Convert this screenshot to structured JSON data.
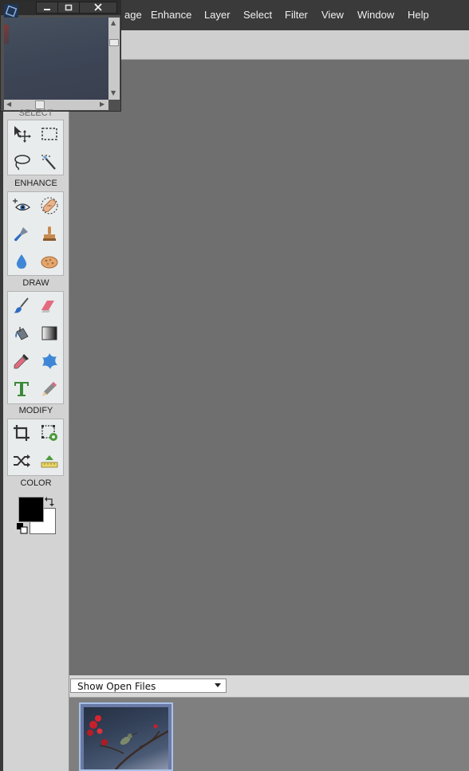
{
  "menubar": {
    "items": [
      "age",
      "Enhance",
      "Layer",
      "Select",
      "Filter",
      "View",
      "Window",
      "Help"
    ]
  },
  "toolbox": {
    "sections": {
      "select": "SELECT",
      "enhance": "ENHANCE",
      "draw": "DRAW",
      "modify": "MODIFY",
      "color": "COLOR"
    }
  },
  "colors": {
    "foreground": "#000000",
    "background": "#ffffff"
  },
  "bin": {
    "select_label": "Show Open Files",
    "thumbnail": "hummingbird-photo"
  },
  "icons": {
    "app": "elements-app-icon",
    "window_buttons": [
      "minimize-icon",
      "maximize-icon",
      "close-icon"
    ],
    "tools": [
      "move-tool-icon",
      "marquee-tool-icon",
      "lasso-tool-icon",
      "quick-selection-tool-icon",
      "red-eye-tool-icon",
      "spot-healing-tool-icon",
      "smart-brush-tool-icon",
      "clone-stamp-tool-icon",
      "blur-tool-icon",
      "sponge-tool-icon",
      "brush-tool-icon",
      "eraser-tool-icon",
      "paint-bucket-tool-icon",
      "gradient-tool-icon",
      "eyedropper-tool-icon",
      "custom-shape-tool-icon",
      "type-tool-icon",
      "pencil-tool-icon",
      "crop-tool-icon",
      "recompose-tool-icon",
      "content-aware-move-tool-icon",
      "straighten-tool-icon"
    ]
  }
}
